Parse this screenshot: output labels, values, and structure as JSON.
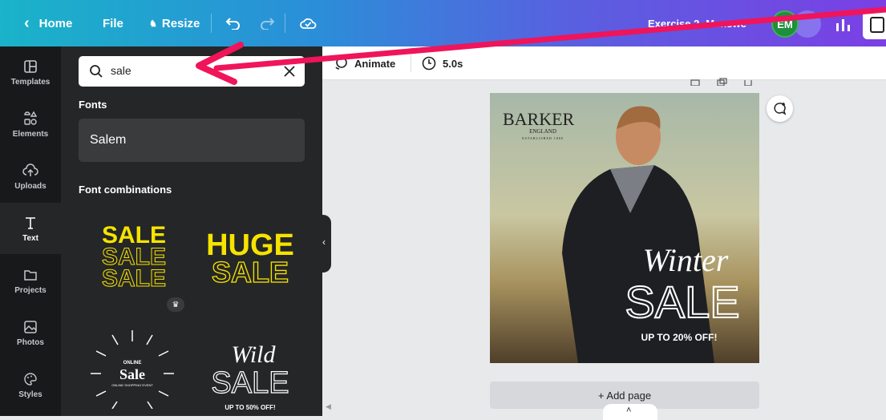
{
  "topbar": {
    "home_label": "Home",
    "file_label": "File",
    "resize_label": "Resize",
    "doc_title": "Exercise 2- Menswe",
    "avatar_initials": "EM"
  },
  "rail": {
    "items": [
      {
        "label": "Templates",
        "icon": "templates-icon"
      },
      {
        "label": "Elements",
        "icon": "elements-icon"
      },
      {
        "label": "Uploads",
        "icon": "uploads-icon"
      },
      {
        "label": "Text",
        "icon": "text-icon"
      },
      {
        "label": "Projects",
        "icon": "projects-icon"
      },
      {
        "label": "Photos",
        "icon": "photos-icon"
      },
      {
        "label": "Styles",
        "icon": "styles-icon"
      }
    ]
  },
  "panel": {
    "search_value": "sale",
    "fonts_heading": "Fonts",
    "font_result": "Salem",
    "combos_heading": "Font combinations",
    "combos": [
      {
        "lines": [
          "SALE",
          "SALE",
          "SALE"
        ]
      },
      {
        "lines": [
          "HUGE",
          "SALE"
        ]
      },
      {
        "top": "ONLINE",
        "main": "Sale",
        "sub": "ONLINE SHOPPING EVENT"
      },
      {
        "script": "Wild",
        "main": "SALE",
        "sub": "UP TO 50% OFF!"
      }
    ]
  },
  "canvas_toolbar": {
    "animate_label": "Animate",
    "duration_label": "5.0s"
  },
  "design": {
    "brand": "BARKER",
    "brand_sub": "ENGLAND",
    "brand_est": "ESTABLISHED 1880",
    "script": "Winter",
    "headline": "SALE",
    "offer": "UP TO 20% OFF!"
  },
  "add_page_label": "+ Add page",
  "colors": {
    "accent_pink": "#f0145a",
    "yellow": "#f5e300"
  }
}
